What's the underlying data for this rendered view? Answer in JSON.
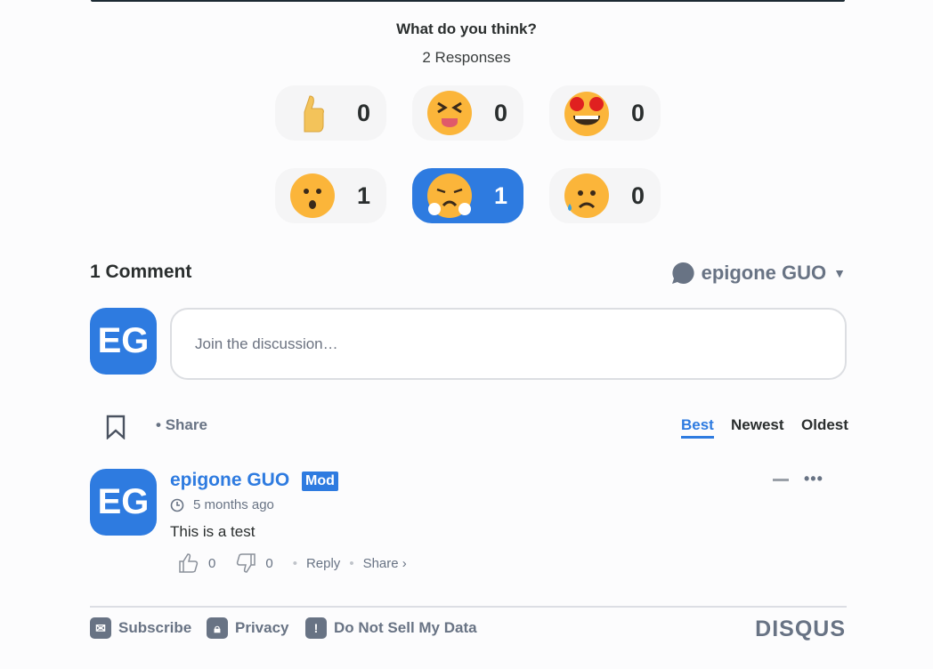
{
  "reactions": {
    "title": "What do you think?",
    "responses": "2 Responses",
    "items": [
      {
        "name": "upvote",
        "count": "0",
        "selected": false
      },
      {
        "name": "funny",
        "count": "0",
        "selected": false
      },
      {
        "name": "love",
        "count": "0",
        "selected": false
      },
      {
        "name": "surprised",
        "count": "1",
        "selected": false
      },
      {
        "name": "angry",
        "count": "1",
        "selected": true
      },
      {
        "name": "sad",
        "count": "0",
        "selected": false
      }
    ]
  },
  "comments_header": {
    "count_label": "1 Comment",
    "user": "epigone GUO"
  },
  "composer": {
    "avatar": "EG",
    "placeholder": "Join the discussion…"
  },
  "toolbar": {
    "share": "Share",
    "sort": [
      "Best",
      "Newest",
      "Oldest"
    ],
    "active_sort": "Best"
  },
  "comment": {
    "avatar": "EG",
    "author": "epigone GUO",
    "badge": "Mod",
    "time": "5 months ago",
    "text": "This is a test",
    "upvotes": "0",
    "downvotes": "0",
    "reply": "Reply",
    "share": "Share ›"
  },
  "footer": {
    "subscribe": "Subscribe",
    "privacy": "Privacy",
    "do_not_sell": "Do Not Sell My Data",
    "brand": "DISQUS"
  },
  "colors": {
    "accent": "#2e7be0",
    "muted": "#687384"
  }
}
